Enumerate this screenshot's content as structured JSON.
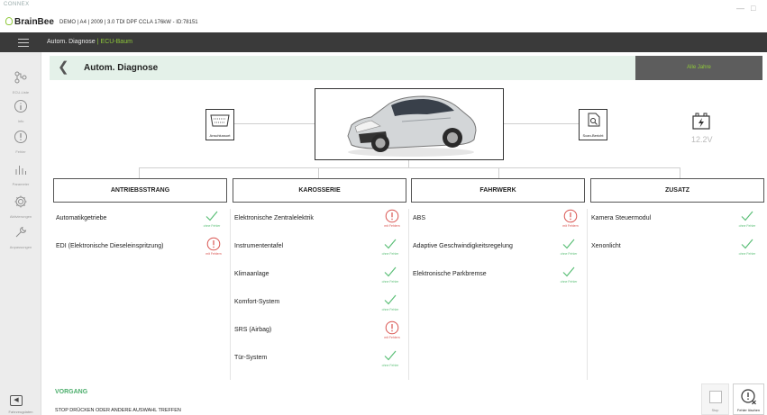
{
  "app": {
    "vendor": "CONNEX",
    "brand": "BrainBee",
    "vehicle_info": "DEMO | A4 | 2009 | 3.0 TDI DPF CCLA 176kW - ID:78151"
  },
  "header": {
    "crumb_root": "Autom. Diagnose",
    "crumb_separator": "|",
    "crumb_active": "ECU-Baum"
  },
  "sidebar": {
    "items": [
      {
        "label": "ECU-Liste",
        "icon": "ecu-tree-icon"
      },
      {
        "label": "Info",
        "icon": "info-icon"
      },
      {
        "label": "Fehler",
        "icon": "warning-icon"
      },
      {
        "label": "Parameter",
        "icon": "bar-chart-icon"
      },
      {
        "label": "Aktivierungen",
        "icon": "gear-icon"
      },
      {
        "label": "Anpassungen",
        "icon": "wrench-icon"
      }
    ],
    "bottom_label": "Fahrzeugdaten"
  },
  "module": {
    "title": "Autom. Diagnose",
    "filter_label": "Alle Jahre"
  },
  "tree": {
    "connector_label": "Anschlussort",
    "report_label": "Scan-Bericht",
    "battery_voltage": "12.2V"
  },
  "colors": {
    "ok": "#5bbf77",
    "error": "#d9534f",
    "accent": "#8fc93a",
    "header_bg": "#e4f1e9"
  },
  "status_labels": {
    "ok": "ohne Fehler",
    "error": "mit Fehlern"
  },
  "categories": [
    {
      "name": "ANTRIEBSSTRANG",
      "ecus": [
        {
          "name": "Automatikgetriebe",
          "status": "ok"
        },
        {
          "name": "EDI (Elektronische Dieseleinspritzung)",
          "status": "error"
        }
      ]
    },
    {
      "name": "KAROSSERIE",
      "ecus": [
        {
          "name": "Elektronische Zentralelektrik",
          "status": "error"
        },
        {
          "name": "Instrumententafel",
          "status": "ok"
        },
        {
          "name": "Klimaanlage",
          "status": "ok"
        },
        {
          "name": "Komfort-System",
          "status": "ok"
        },
        {
          "name": "SRS (Airbag)",
          "status": "error"
        },
        {
          "name": "Tür-System",
          "status": "ok"
        }
      ]
    },
    {
      "name": "FAHRWERK",
      "ecus": [
        {
          "name": "ABS",
          "status": "error"
        },
        {
          "name": "Adaptive Geschwindigkeitsregelung",
          "status": "ok"
        },
        {
          "name": "Elektronische Parkbremse",
          "status": "ok"
        }
      ]
    },
    {
      "name": "ZUSATZ",
      "ecus": [
        {
          "name": "Kamera Steuermodul",
          "status": "ok"
        },
        {
          "name": "Xenonlicht",
          "status": "ok"
        }
      ]
    }
  ],
  "footer": {
    "process_title": "VORGANG",
    "process_message": "STOP DRÜCKEN ODER ANDERE AUSWAHL TREFFEN",
    "stop_label": "Stop",
    "clear_label": "Fehler löschen"
  }
}
